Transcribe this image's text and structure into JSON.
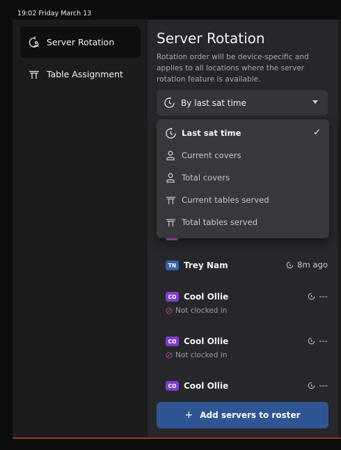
{
  "status_bar": {
    "datetime": "19:02  Friday March 13"
  },
  "sidebar": {
    "items": [
      {
        "label": "Server Rotation",
        "icon": "server-rotation-icon",
        "active": true
      },
      {
        "label": "Table Assignment",
        "icon": "table-icon",
        "active": false
      }
    ]
  },
  "main": {
    "title": "Server Rotation",
    "description": "Rotation order will be device-specific and applies to all locations where the server rotation feature is available.",
    "sort_select": {
      "value": "By last sat time",
      "icon": "clock-icon"
    },
    "dropdown": {
      "options": [
        {
          "label": "Last sat time",
          "icon": "clock-icon",
          "selected": true,
          "check": "✓"
        },
        {
          "label": "Current covers",
          "icon": "person-icon",
          "selected": false
        },
        {
          "label": "Total covers",
          "icon": "person-icon",
          "selected": false
        },
        {
          "label": "Current tables served",
          "icon": "table-icon",
          "selected": false
        },
        {
          "label": "Total tables served",
          "icon": "table-icon",
          "selected": false
        }
      ]
    },
    "servers": [
      {
        "initials": "TN",
        "name": "Trey Nam",
        "time": "8m ago",
        "badge_color": "#3b5fa8",
        "status": ""
      },
      {
        "initials": "CO",
        "name": "Cool Ollie",
        "time": "---",
        "badge_color": "#7b3fc9",
        "status": "Not clocked in"
      },
      {
        "initials": "CO",
        "name": "Cool Ollie",
        "time": "---",
        "badge_color": "#7b3fc9",
        "status": "Not clocked in"
      },
      {
        "initials": "CO",
        "name": "Cool Ollie",
        "time": "---",
        "badge_color": "#7b3fc9",
        "status": ""
      }
    ],
    "add_button": {
      "plus": "+",
      "label": "Add servers to roster"
    }
  },
  "colors": {
    "accent": "#2f5693",
    "background": "#26272a",
    "sidebar": "#1c1c1e"
  }
}
